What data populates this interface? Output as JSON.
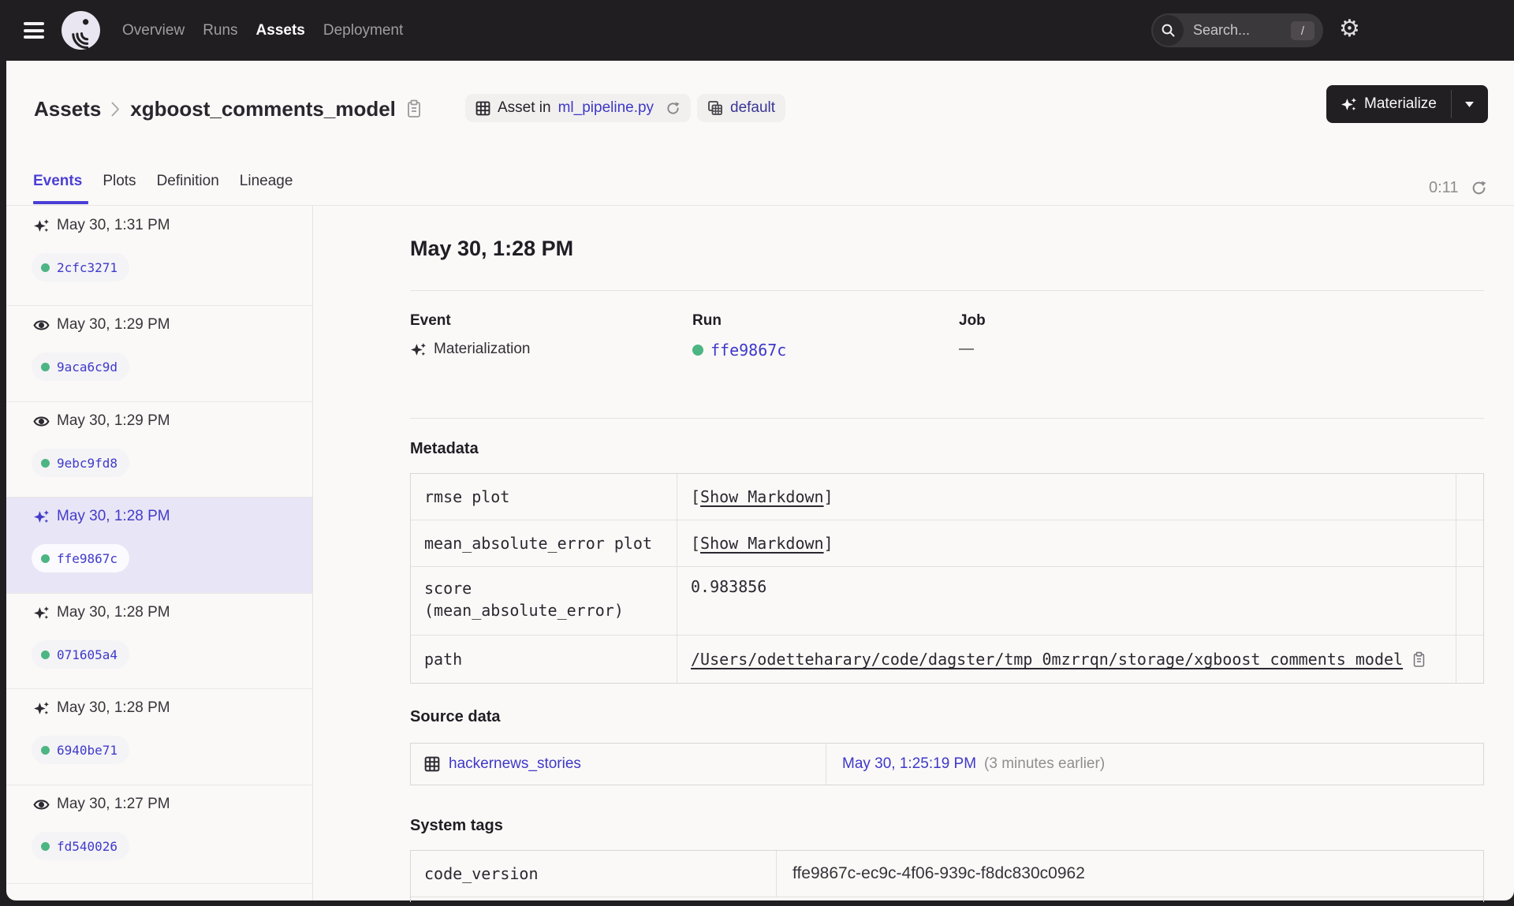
{
  "colors": {
    "nav_bg": "#211E21",
    "page_bg": "#FAF9F7",
    "accent": "#4B3FD6",
    "link": "#3E38C8",
    "success_green": "#4CB583",
    "selected_row_bg": "#E8E5F6"
  },
  "topnav": {
    "items": [
      {
        "label": "Overview",
        "active": false
      },
      {
        "label": "Runs",
        "active": false
      },
      {
        "label": "Assets",
        "active": true
      },
      {
        "label": "Deployment",
        "active": false
      }
    ],
    "search": {
      "placeholder": "Search...",
      "shortcut": "/"
    }
  },
  "header": {
    "breadcrumb_root": "Assets",
    "breadcrumb_current": "xgboost_comments_model",
    "asset_in_prefix": "Asset in",
    "asset_in_file": "ml_pipeline.py",
    "group_badge": "default",
    "materialize_label": "Materialize"
  },
  "tabs": {
    "items": [
      {
        "label": "Events",
        "active": true
      },
      {
        "label": "Plots",
        "active": false
      },
      {
        "label": "Definition",
        "active": false
      },
      {
        "label": "Lineage",
        "active": false
      }
    ],
    "refresh_timer": "0:11"
  },
  "sidebar": {
    "events": [
      {
        "type": "materialization",
        "time": "May 30, 1:31 PM",
        "run_id": "2cfc3271",
        "selected": false
      },
      {
        "type": "observation",
        "time": "May 30, 1:29 PM",
        "run_id": "9aca6c9d",
        "selected": false
      },
      {
        "type": "observation",
        "time": "May 30, 1:29 PM",
        "run_id": "9ebc9fd8",
        "selected": false
      },
      {
        "type": "materialization",
        "time": "May 30, 1:28 PM",
        "run_id": "ffe9867c",
        "selected": true
      },
      {
        "type": "materialization",
        "time": "May 30, 1:28 PM",
        "run_id": "071605a4",
        "selected": false
      },
      {
        "type": "materialization",
        "time": "May 30, 1:28 PM",
        "run_id": "6940be71",
        "selected": false
      },
      {
        "type": "observation",
        "time": "May 30, 1:27 PM",
        "run_id": "fd540026",
        "selected": false
      }
    ]
  },
  "detail": {
    "title": "May 30, 1:28 PM",
    "event_label": "Event",
    "event_value": "Materialization",
    "run_label": "Run",
    "run_value": "ffe9867c",
    "job_label": "Job",
    "job_value": "—",
    "metadata": {
      "heading": "Metadata",
      "keys": [
        "rmse plot",
        "mean_absolute_error plot",
        "score\n(mean_absolute_error)",
        "path"
      ],
      "show_markdown_open": "[",
      "show_markdown_label": "Show Markdown",
      "show_markdown_close": "]",
      "score_value": "0.983856",
      "path_value": "/Users/odetteharary/code/dagster/tmp_0mzrrqn/storage/xgboost_comments_model"
    },
    "source_data": {
      "heading": "Source data",
      "asset_name": "hackernews_stories",
      "time": "May 30, 1:25:19 PM",
      "time_note": "(3 minutes earlier)"
    },
    "system_tags": {
      "heading": "System tags",
      "key": "code_version",
      "value": "ffe9867c-ec9c-4f06-939c-f8dc830c0962"
    }
  }
}
